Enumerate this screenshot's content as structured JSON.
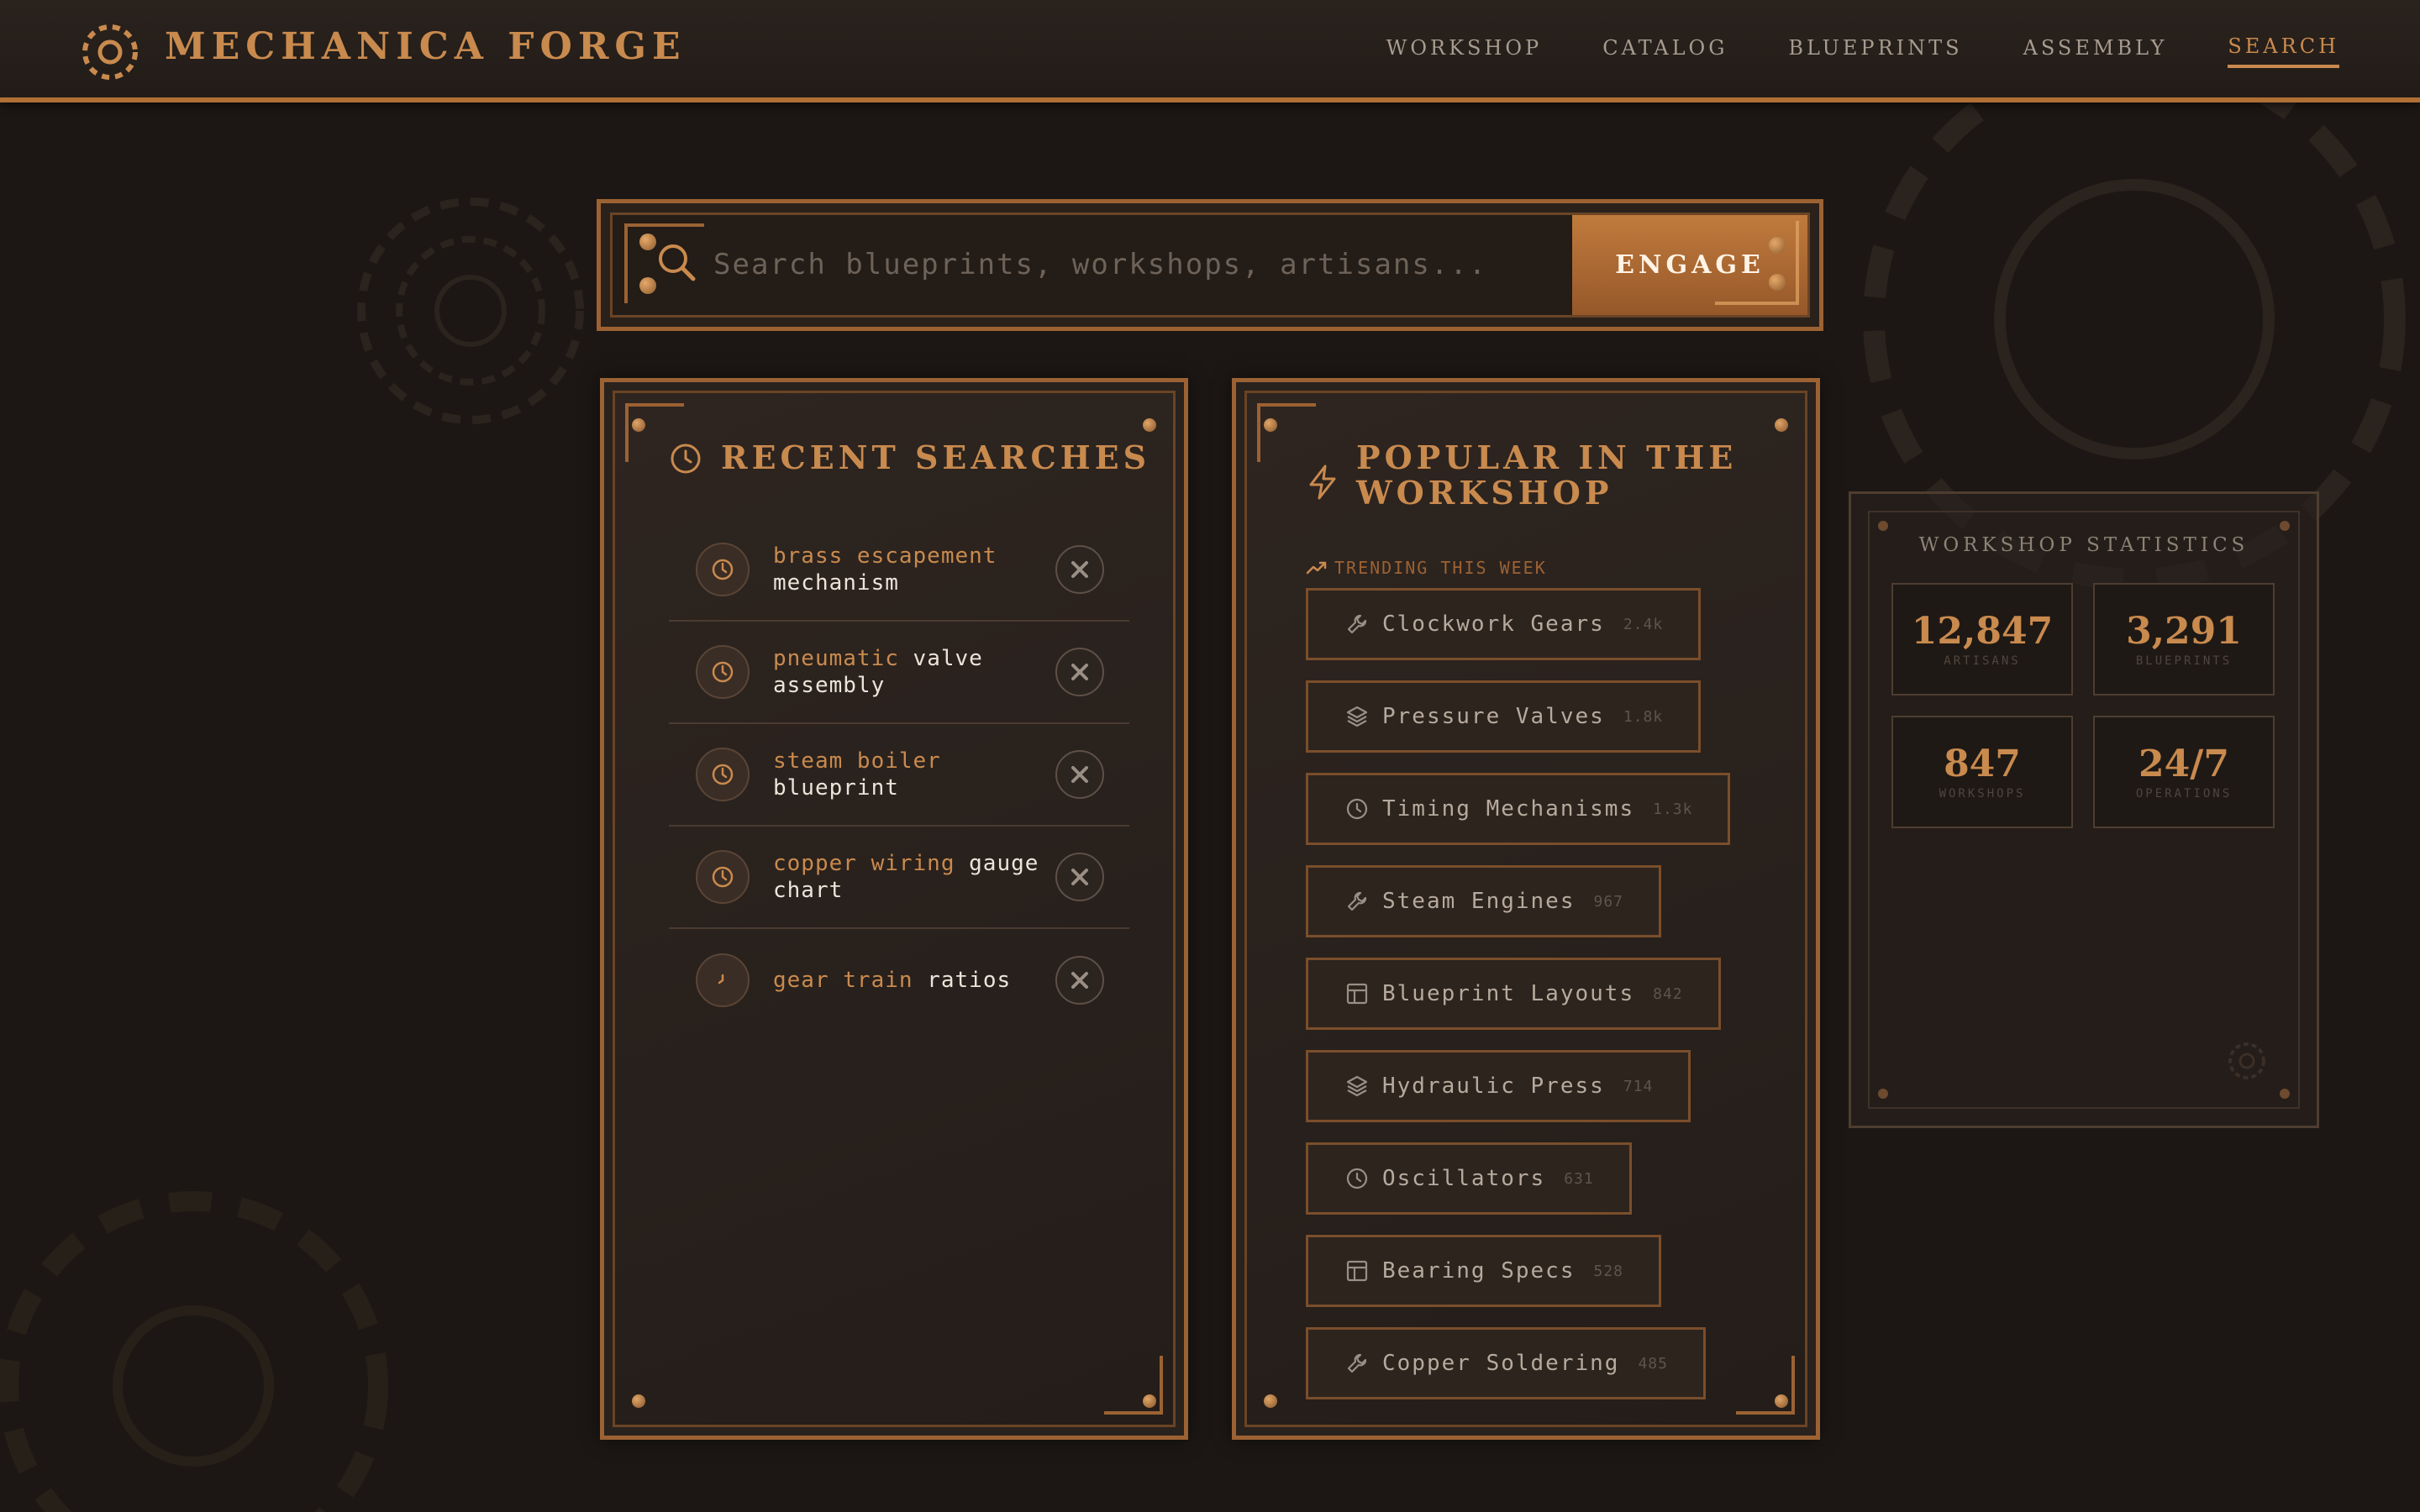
{
  "brand": {
    "name": "MECHANICA FORGE"
  },
  "nav": [
    {
      "label": "WORKSHOP",
      "active": false
    },
    {
      "label": "CATALOG",
      "active": false
    },
    {
      "label": "BLUEPRINTS",
      "active": false
    },
    {
      "label": "ASSEMBLY",
      "active": false
    },
    {
      "label": "SEARCH",
      "active": true
    }
  ],
  "search": {
    "placeholder": "Search blueprints, workshops, artisans...",
    "value": "",
    "button_label": "ENGAGE"
  },
  "recent": {
    "title": "RECENT SEARCHES",
    "items": [
      {
        "accent": "brass escapement",
        "rest": "mechanism"
      },
      {
        "accent": "pneumatic",
        "rest": "valve assembly"
      },
      {
        "accent": "steam boiler",
        "rest": "blueprint"
      },
      {
        "accent": "copper wiring",
        "rest": "gauge chart"
      },
      {
        "accent": "gear train",
        "rest": "ratios"
      }
    ]
  },
  "popular": {
    "title_line1": "POPULAR IN THE",
    "title_line2": "WORKSHOP",
    "trending_label": "TRENDING THIS WEEK",
    "items": [
      {
        "label": "Clockwork Gears",
        "count": "2.4k",
        "icon": "wrench-icon"
      },
      {
        "label": "Pressure Valves",
        "count": "1.8k",
        "icon": "layers-icon"
      },
      {
        "label": "Timing Mechanisms",
        "count": "1.3k",
        "icon": "clock-icon"
      },
      {
        "label": "Steam Engines",
        "count": "967",
        "icon": "wrench-icon"
      },
      {
        "label": "Blueprint Layouts",
        "count": "842",
        "icon": "layout-icon"
      },
      {
        "label": "Hydraulic Press",
        "count": "714",
        "icon": "layers-icon"
      },
      {
        "label": "Oscillators",
        "count": "631",
        "icon": "clock-icon"
      },
      {
        "label": "Bearing Specs",
        "count": "528",
        "icon": "layout-icon"
      },
      {
        "label": "Copper Soldering",
        "count": "485",
        "icon": "wrench-icon"
      }
    ]
  },
  "stats": {
    "title": "WORKSHOP STATISTICS",
    "items": [
      {
        "value": "12,847",
        "label": "ARTISANS"
      },
      {
        "value": "3,291",
        "label": "BLUEPRINTS"
      },
      {
        "value": "847",
        "label": "WORKSHOPS"
      },
      {
        "value": "24/7",
        "label": "OPERATIONS"
      }
    ]
  },
  "colors": {
    "accent": "#c98a4e",
    "copper": "#9c6233",
    "background": "#1c1714"
  }
}
